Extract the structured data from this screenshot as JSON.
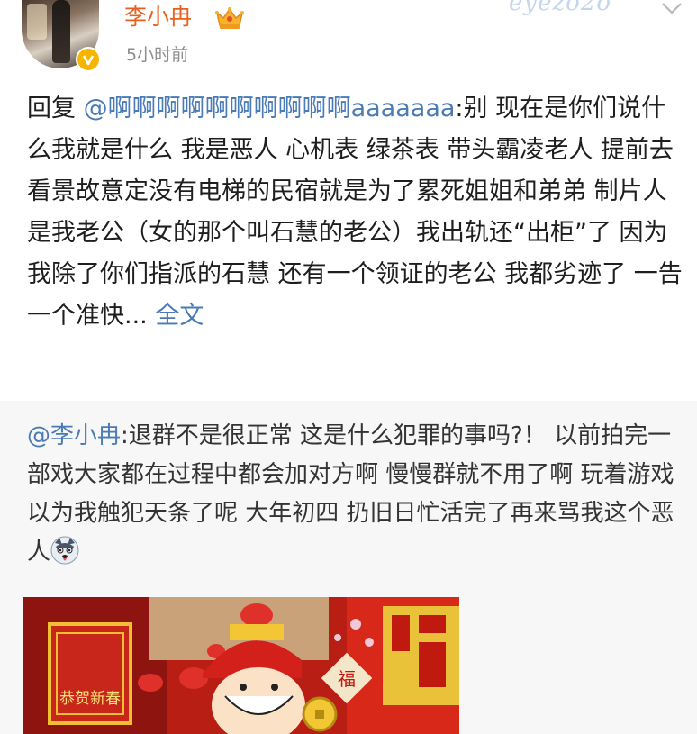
{
  "post": {
    "author": "李小冉",
    "timestamp": "5小时前",
    "watermark": "eyezo2o",
    "reply_prefix": "回复",
    "reply_mention": "@啊啊啊啊啊啊啊啊啊啊aaaaaaa",
    "body": ":别 现在是你们说什么我就是什么 我是恶人 心机表 绿茶表 带头霸凌老人 提前去看景故意定没有电梯的民宿就是为了累死姐姐和弟弟  制片人是我老公（女的那个叫石慧的老公）我出轨还“出柜”了  因为我除了你们指派的石慧 还有一个领证的老公 我都劣迹了 一告一个准快...",
    "more_link": "全文"
  },
  "quoted": {
    "mention": "@李小冉",
    "body": ":退群不是很正常 这是什么犯罪的事吗?！ 以前拍完一部戏大家都在过程中都会加对方啊 慢慢群就不用了啊    玩着游戏以为我触犯天条了呢 大年初四 扔旧日忙活完了再来骂我这个恶人",
    "image_sign": "恭贺新春",
    "image_fu": "福"
  },
  "colors": {
    "username": "#e8601c",
    "link": "#4a7bb5",
    "quoted_bg": "#f7f7f7",
    "verified": "#f7b500"
  }
}
